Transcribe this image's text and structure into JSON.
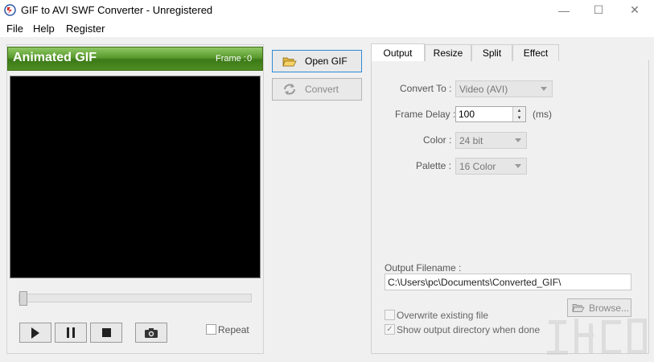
{
  "window": {
    "title": "GIF to AVI SWF Converter - Unregistered",
    "minimize_glyph": "—",
    "maximize_glyph": "☐",
    "close_glyph": "✕"
  },
  "menu": {
    "file": "File",
    "help": "Help",
    "register": "Register"
  },
  "preview": {
    "header_title": "Animated GIF",
    "frame_label": "Frame :",
    "frame_value": "0",
    "repeat_label": "Repeat",
    "repeat_checked": false,
    "position_fraction": 0.0
  },
  "actions": {
    "open_gif": "Open GIF",
    "convert": "Convert"
  },
  "tabs": [
    {
      "label": "Output",
      "active": true
    },
    {
      "label": "Resize",
      "active": false
    },
    {
      "label": "Split",
      "active": false
    },
    {
      "label": "Effect",
      "active": false
    }
  ],
  "output": {
    "convert_to_label": "Convert To :",
    "convert_to_value": "Video (AVI)",
    "frame_delay_label": "Frame Delay :",
    "frame_delay_value": "100",
    "frame_delay_unit": "(ms)",
    "color_label": "Color :",
    "color_value": "24 bit",
    "palette_label": "Palette :",
    "palette_value": "16 Color",
    "filename_label": "Output Filename :",
    "filename_value": "C:\\Users\\pc\\Documents\\Converted_GIF\\",
    "browse_label": "Browse...",
    "overwrite_label": "Overwrite existing file",
    "overwrite_checked": false,
    "show_dir_label": "Show output directory when done",
    "show_dir_checked": true
  },
  "icons": {
    "app": "app-logo-icon",
    "open": "folder-open-icon",
    "convert": "convert-icon",
    "browse": "folder-open-icon",
    "play": "play-icon",
    "pause": "pause-icon",
    "stop": "stop-icon",
    "snapshot": "camera-icon"
  },
  "colors": {
    "header_green": "#4f8c24",
    "focus_blue": "#2e8bd6",
    "preview_black": "#000000"
  }
}
